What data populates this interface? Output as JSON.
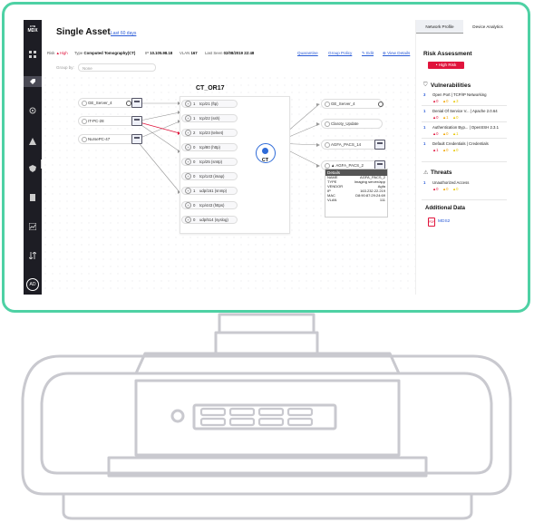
{
  "app": {
    "logo_line1": "CYB",
    "logo_line2": "MDX",
    "avatar_initials": "AD"
  },
  "header": {
    "title": "Single Asset",
    "period_link": "Last 60 days",
    "risk_label": "Risk",
    "risk_value": "▲High",
    "type_label": "Type",
    "type_value": "Computed Tomography(CT)",
    "ip_label": "IP",
    "ip_value": "10.105.98.18",
    "vlan_label": "VLAN",
    "vlan_value": "167",
    "lastseen_label": "Last Seen",
    "lastseen_value": "02/08/2019 22:48",
    "actions": {
      "quarantine": "Quarantine",
      "group_policy": "Group Policy",
      "edit": "✎ Edit",
      "view_details": "⊕ View Details"
    }
  },
  "groupby": {
    "label": "Group by:",
    "value": "None"
  },
  "device_name": "CT_OR17",
  "hub_label": "CT",
  "left_devices": [
    {
      "label": "GE_Server_4"
    },
    {
      "label": "IT-PC-28"
    },
    {
      "label": "NursePC-47"
    }
  ],
  "ports": [
    {
      "num": "1",
      "name": "tcp/21 (ftp)"
    },
    {
      "num": "1",
      "name": "tcp/22 (ssh)"
    },
    {
      "num": "2",
      "name": "tcp/23 (telnet)"
    },
    {
      "num": "0",
      "name": "tcp/80 (http)"
    },
    {
      "num": "0",
      "name": "tcp/25 (smtp)"
    },
    {
      "num": "0",
      "name": "tcp/143 (imap)"
    },
    {
      "num": "1",
      "name": "udp/161 (snmp)"
    },
    {
      "num": "0",
      "name": "tcp/443 (https)"
    },
    {
      "num": "0",
      "name": "udp/514 (syslog)"
    }
  ],
  "right_devices": [
    {
      "label": "GE_Server_4"
    },
    {
      "label": "Claroty_Update"
    },
    {
      "label": "AGFA_PACS_14"
    },
    {
      "label": "▲ AGFA_PACS_2"
    }
  ],
  "details": {
    "header": "Details",
    "rows": [
      {
        "k": "NAME",
        "v": "AGFA_PACS_2"
      },
      {
        "k": "TYPE",
        "v": "Imaging server/app"
      },
      {
        "k": "VENDOR",
        "v": "Agfa"
      },
      {
        "k": "IP",
        "v": "163.232.22.219"
      },
      {
        "k": "MAC",
        "v": "D8:90:87:29:24:69"
      },
      {
        "k": "VLAN",
        "v": "111"
      }
    ]
  },
  "right_panel": {
    "tabs": [
      "Network Profile",
      "Device Analytics"
    ],
    "risk_title": "Risk Assessment",
    "risk_badge": "• High Risk",
    "vuln_title": "Vulnerabilities",
    "vulns": [
      {
        "count": "3",
        "name": "Open Port | TCP/IP Networking",
        "sev": [
          "▲0",
          "▲0",
          "▲3"
        ]
      },
      {
        "count": "1",
        "name": "Denial Of Service V... | Apache 2.0.64",
        "sev": [
          "▲0",
          "▲1",
          "▲0"
        ]
      },
      {
        "count": "1",
        "name": "Authentication Byp... | OpenSSH 2.3.1",
        "sev": [
          "▲0",
          "▲0",
          "▲1"
        ]
      },
      {
        "count": "1",
        "name": "Default Credentials | Credentials",
        "sev": [
          "▲1",
          "▲0",
          "▲0"
        ]
      }
    ],
    "threats_title": "Threats",
    "threats": [
      {
        "count": "1",
        "name": "Unauthorized Access",
        "sev": [
          "▲0",
          "▲0",
          "▲0"
        ]
      }
    ],
    "additional_title": "Additional Data",
    "additional_link": "MDS2",
    "additional_icon": "PDF"
  },
  "colors": {
    "accent": "#4ed1a4",
    "high_risk": "#e0143c",
    "link": "#2a5bd7",
    "sidebar": "#1d1d24"
  }
}
